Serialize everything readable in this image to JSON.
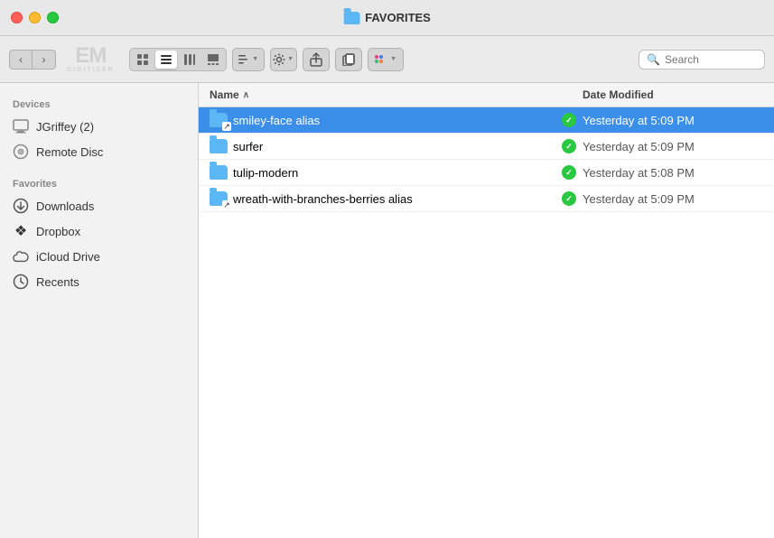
{
  "titlebar": {
    "title": "FAVORITES",
    "traffic_lights": [
      "red",
      "yellow",
      "green"
    ]
  },
  "toolbar": {
    "back_label": "‹",
    "forward_label": "›",
    "watermark_line1": "EM",
    "watermark_line2": "DIGITIZER",
    "search_placeholder": "Search",
    "view_buttons": [
      "⊞",
      "≡",
      "⊟",
      "⊠"
    ],
    "active_view_index": 1
  },
  "sidebar": {
    "sections": [
      {
        "label": "Devices",
        "items": [
          {
            "id": "jgriffey",
            "label": "JGriffey (2)",
            "icon": "screen"
          },
          {
            "id": "remote-disc",
            "label": "Remote Disc",
            "icon": "disc"
          }
        ]
      },
      {
        "label": "Favorites",
        "items": [
          {
            "id": "downloads",
            "label": "Downloads",
            "icon": "⬇"
          },
          {
            "id": "dropbox",
            "label": "Dropbox",
            "icon": "❖"
          },
          {
            "id": "icloud",
            "label": "iCloud Drive",
            "icon": "☁"
          },
          {
            "id": "recents",
            "label": "Recents",
            "icon": "🕐"
          }
        ]
      }
    ]
  },
  "file_list": {
    "columns": [
      {
        "id": "name",
        "label": "Name",
        "sort": "asc"
      },
      {
        "id": "date",
        "label": "Date Modified"
      }
    ],
    "rows": [
      {
        "id": 1,
        "name": "smiley-face alias",
        "alias": true,
        "status": "ok",
        "date": "Yesterday at 5:09 PM",
        "selected": true
      },
      {
        "id": 2,
        "name": "surfer",
        "alias": false,
        "status": "ok",
        "date": "Yesterday at 5:09 PM",
        "selected": false
      },
      {
        "id": 3,
        "name": "tulip-modern",
        "alias": false,
        "status": "ok",
        "date": "Yesterday at 5:08 PM",
        "selected": false
      },
      {
        "id": 4,
        "name": "wreath-with-branches-berries alias",
        "alias": true,
        "status": "ok",
        "date": "Yesterday at 5:09 PM",
        "selected": false
      }
    ]
  },
  "colors": {
    "selection_bg": "#3c8fe8",
    "folder_blue": "#5bb8f5",
    "status_green": "#28c840"
  }
}
